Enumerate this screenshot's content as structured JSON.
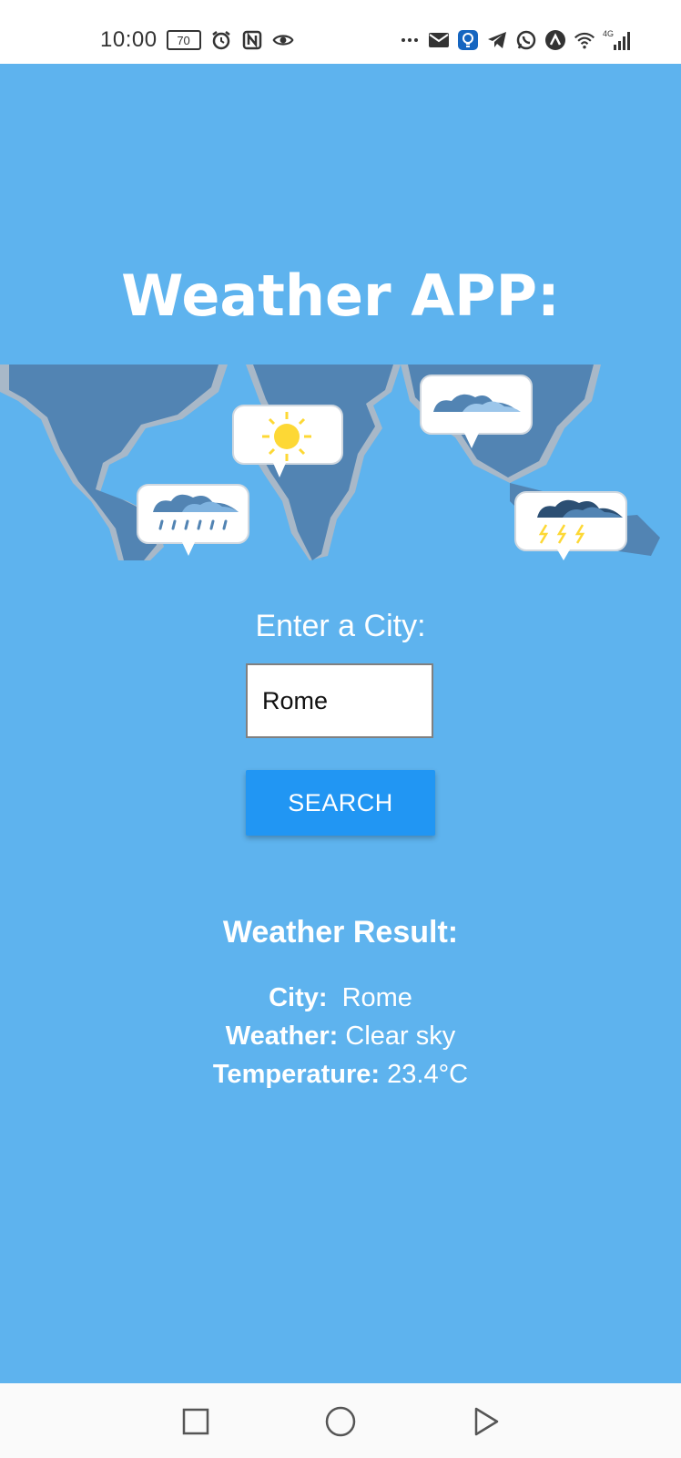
{
  "status_bar": {
    "time": "10:00",
    "battery": "70",
    "left_icons": [
      "alarm-icon",
      "nfc-icon",
      "eye-icon"
    ],
    "right_icons": [
      "more-dots-icon",
      "mail-icon",
      "bulb-app-icon",
      "telegram-icon",
      "whatsapp-icon",
      "app-a-icon",
      "wifi-icon",
      "signal-4g-icon"
    ],
    "network_label": "4G"
  },
  "app": {
    "title": "Weather APP:",
    "background_color": "#5eb3ee",
    "accent_color": "#2196f3"
  },
  "search": {
    "label": "Enter a City:",
    "input_value": "Rome",
    "button_label": "SEARCH"
  },
  "result": {
    "title": "Weather Result:",
    "city_label": "City:",
    "city_value": "Rome",
    "weather_label": "Weather:",
    "weather_value": "Clear sky",
    "temperature_label": "Temperature:",
    "temperature_value": "23.4°C"
  },
  "nav_bar": {
    "buttons": [
      "recent-apps-icon",
      "home-icon",
      "back-icon"
    ]
  }
}
